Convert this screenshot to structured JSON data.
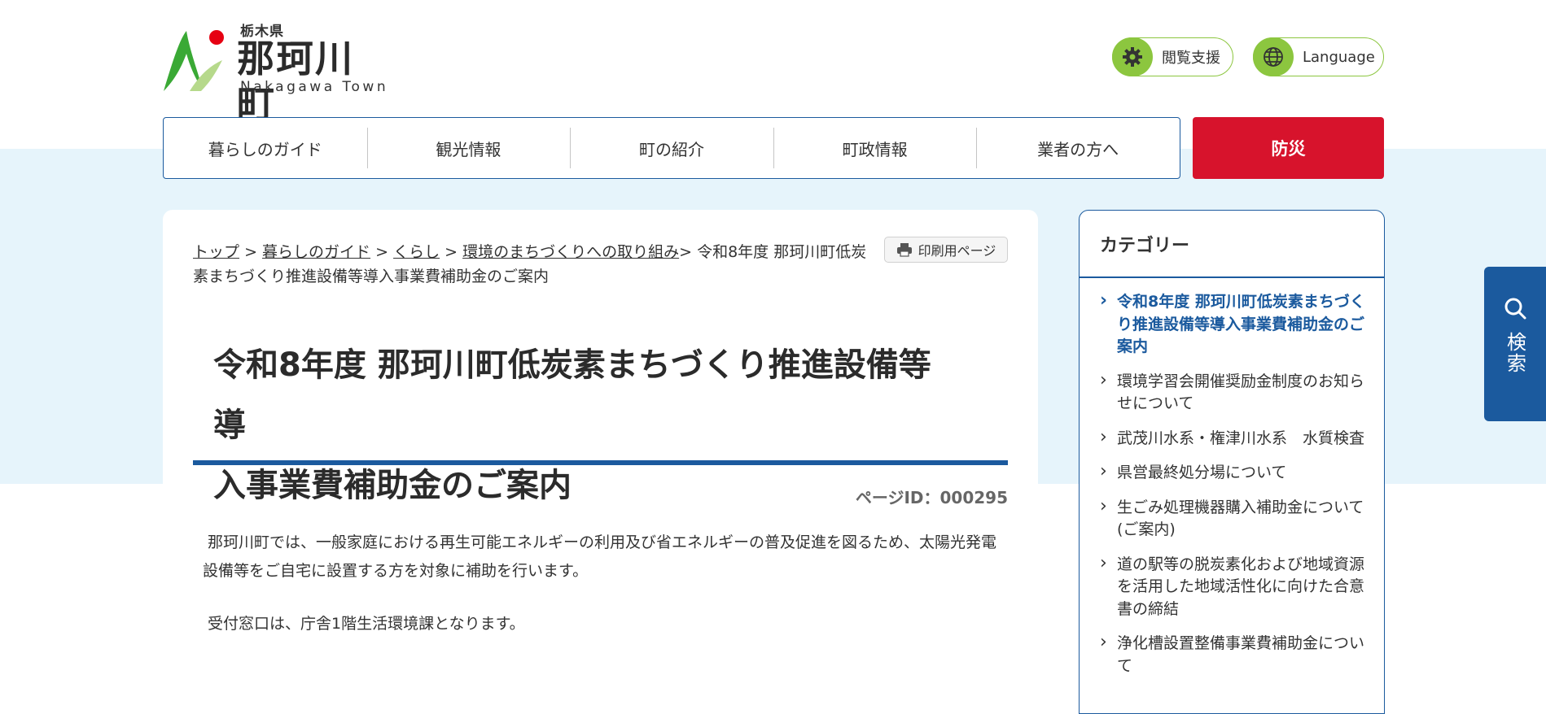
{
  "header": {
    "logo": {
      "prefecture": "栃木県",
      "name": "那珂川町",
      "english": "Nakagawa Town"
    },
    "accessibility_label": "閲覧支援",
    "language_label": "Language"
  },
  "nav": {
    "items": [
      "暮らしのガイド",
      "観光情報",
      "町の紹介",
      "町政情報",
      "業者の方へ"
    ],
    "disaster_label": "防災"
  },
  "breadcrumb": {
    "links": [
      "トップ",
      "暮らしのガイド",
      "くらし",
      "環境のまちづくりへの取り組み"
    ],
    "separator": ">",
    "current": "令和8年度 那珂川町低炭素まちづくり推進設備等導入事業費補助金のご案内"
  },
  "print_label": "印刷用ページ",
  "page": {
    "title_line1": "令和8年度 那珂川町低炭素まちづくり推進設備等導",
    "title_line2": "入事業費補助金のご案内",
    "page_id": "ページID：000295",
    "paragraph1": "那珂川町では、一般家庭における再生可能エネルギーの利用及び省エネルギーの普及促進を図るため、太陽光発電設備等をご自宅に設置する方を対象に補助を行います。",
    "paragraph2": "受付窓口は、庁舎1階生活環境課となります。"
  },
  "sidebar": {
    "title": "カテゴリー",
    "items": [
      "令和8年度 那珂川町低炭素まちづくり推進設備等導入事業費補助金のご案内",
      "環境学習会開催奨励金制度のお知らせについて",
      "武茂川水系・権津川水系　水質検査",
      "県営最終処分場について",
      "生ごみ処理機器購入補助金について(ご案内)",
      "道の駅等の脱炭素化および地域資源を活用した地域活性化に向けた合意書の締結",
      "浄化槽設置整備事業費補助金について"
    ]
  },
  "search": {
    "label": "検索"
  },
  "colors": {
    "brand_blue": "#1b5a9e",
    "disaster_red": "#d7132c",
    "green": "#8cc63f",
    "band": "#e6f4fb"
  }
}
